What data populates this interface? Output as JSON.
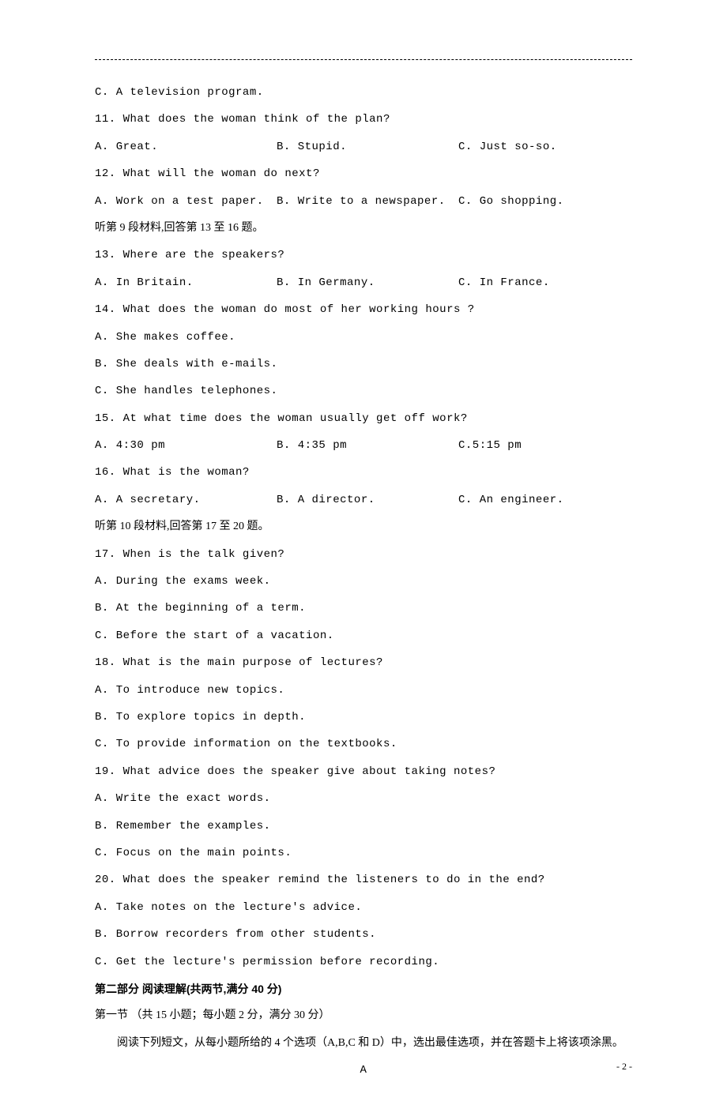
{
  "lines": {
    "l0": "C. A television program.",
    "q11": "11. What does the woman think of the plan?",
    "q11a": "A. Great.",
    "q11b": "B. Stupid.",
    "q11c": "C. Just so-so.",
    "q12": "12. What will the woman do next?",
    "q12a": "A. Work on a test paper.",
    "q12b": "B. Write to a newspaper.",
    "q12c": "C. Go shopping.",
    "seg9": "听第 9 段材料,回答第 13 至 16 题。",
    "q13": "13. Where are the speakers?",
    "q13a": "A. In Britain.",
    "q13b": "B. In Germany.",
    "q13c": "C. In France.",
    "q14": "14. What does the woman do most of her working hours ?",
    "q14a": "A. She makes coffee.",
    "q14b": "B. She deals with e-mails.",
    "q14c": "C. She handles telephones.",
    "q15": "15. At what time does the woman usually get off work?",
    "q15a": "A. 4:30 pm",
    "q15b": "B. 4:35 pm",
    "q15c": "C.5:15 pm",
    "q16": "16. What is the woman?",
    "q16a": "A. A secretary.",
    "q16b": "B. A director.",
    "q16c": "C. An engineer.",
    "seg10": "听第 10 段材料,回答第 17 至 20 题。",
    "q17": "17. When is the talk given?",
    "q17a": "A. During the exams week.",
    "q17b": "B. At the beginning of a term.",
    "q17c": "C. Before the start of a vacation.",
    "q18": "18. What is the main purpose of lectures?",
    "q18a": "A. To introduce new topics.",
    "q18b": "B. To explore topics in depth.",
    "q18c": "C. To provide information on the textbooks.",
    "q19": "19. What advice does the speaker give about taking notes?",
    "q19a": "A. Write the exact words.",
    "q19b": "B. Remember the examples.",
    "q19c": "C. Focus on the main points.",
    "q20": "20. What does the speaker remind the listeners to do in the end?",
    "q20a": "A. Take notes on the lecture's advice.",
    "q20b": "B. Borrow recorders from other students.",
    "q20c": "C. Get the lecture's permission before recording.",
    "part2": "第二部分 阅读理解(共两节,满分 40 分)",
    "sec1": "第一节 （共 15 小题；每小题 2 分，满分 30 分）",
    "instr": "阅读下列短文，从每小题所给的 4 个选项（A,B,C 和 D）中，选出最佳选项，并在答题卡上将该项涂黑。",
    "passageA": "A",
    "pageNum": "- 2 -"
  }
}
